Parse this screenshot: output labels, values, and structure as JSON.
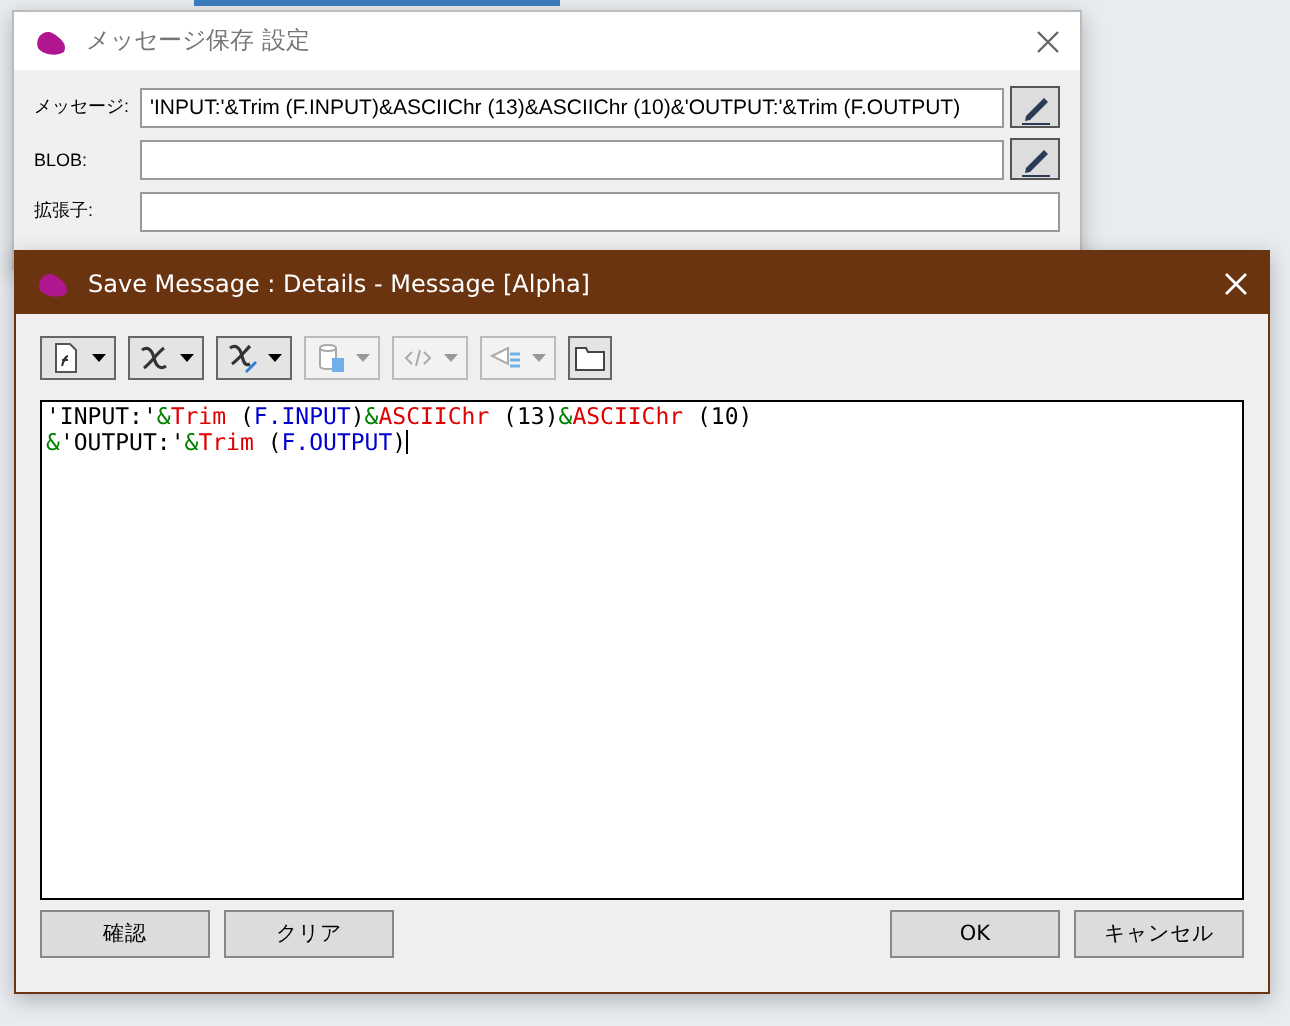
{
  "back_window": {
    "title": "メッセージ保存 設定",
    "fields": [
      {
        "label": "メッセージ:",
        "value": "'INPUT:'&Trim (F.INPUT)&ASCIIChr (13)&ASCIIChr (10)&'OUTPUT:'&Trim (F.OUTPUT)",
        "edit_button": true
      },
      {
        "label": "BLOB:",
        "edit_button": true
      },
      {
        "label": "拡張子:",
        "edit_button": false
      }
    ]
  },
  "dialog": {
    "title": "Save Message : Details - Message [Alpha]",
    "toolbar": [
      {
        "kind": "function",
        "disabled": false,
        "dropdown": true
      },
      {
        "kind": "variable",
        "disabled": false,
        "dropdown": true
      },
      {
        "kind": "variable-percent",
        "disabled": false,
        "dropdown": true
      },
      {
        "kind": "database",
        "disabled": true,
        "dropdown": true
      },
      {
        "kind": "code",
        "disabled": true,
        "dropdown": true
      },
      {
        "kind": "tree",
        "disabled": true,
        "dropdown": true
      },
      {
        "kind": "folder",
        "disabled": false,
        "dropdown": false
      }
    ],
    "editor_lines": [
      [
        {
          "kind": "string",
          "text": "'INPUT:'"
        },
        {
          "kind": "operator",
          "text": "&"
        },
        {
          "kind": "function",
          "text": "Trim"
        },
        {
          "kind": "plain",
          "text": " ("
        },
        {
          "kind": "field",
          "text": "F.INPUT"
        },
        {
          "kind": "plain",
          "text": ")"
        },
        {
          "kind": "operator",
          "text": "&"
        },
        {
          "kind": "function",
          "text": "ASCIIChr"
        },
        {
          "kind": "plain",
          "text": " (13)"
        },
        {
          "kind": "operator",
          "text": "&"
        },
        {
          "kind": "function",
          "text": "ASCIIChr"
        },
        {
          "kind": "plain",
          "text": " (10)"
        }
      ],
      [
        {
          "kind": "operator",
          "text": "&"
        },
        {
          "kind": "string",
          "text": "'OUTPUT:'"
        },
        {
          "kind": "operator",
          "text": "&"
        },
        {
          "kind": "function",
          "text": "Trim"
        },
        {
          "kind": "plain",
          "text": " ("
        },
        {
          "kind": "field",
          "text": "F.OUTPUT"
        },
        {
          "kind": "plain",
          "text": ")"
        }
      ]
    ],
    "left_buttons": [
      "確認",
      "クリア"
    ],
    "right_buttons": [
      "OK",
      "キャンセル"
    ]
  }
}
